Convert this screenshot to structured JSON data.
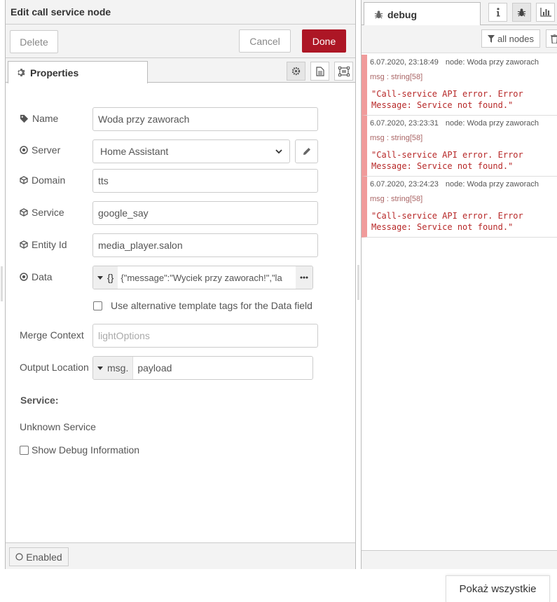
{
  "editor": {
    "title": "Edit call service node",
    "delete_label": "Delete",
    "cancel_label": "Cancel",
    "done_label": "Done",
    "tab_properties": "Properties",
    "form": {
      "name_label": "Name",
      "name_value": "Woda przy zaworach",
      "server_label": "Server",
      "server_value": "Home Assistant",
      "domain_label": "Domain",
      "domain_value": "tts",
      "service_label": "Service",
      "service_value": "google_say",
      "entity_label": "Entity Id",
      "entity_value": "media_player.salon",
      "data_label": "Data",
      "data_type": "{}",
      "data_value": "{\"message\":\"Wyciek przy zaworach!\",\"la",
      "alt_tags_label": "Use alternative template tags for the Data field",
      "merge_label": "Merge Context",
      "merge_placeholder": "lightOptions",
      "output_label": "Output Location",
      "output_type": "msg.",
      "output_value": "payload",
      "service_heading": "Service:",
      "service_text": "Unknown Service",
      "debug_label": "Show Debug Information"
    },
    "enabled_label": "Enabled"
  },
  "sidebar": {
    "tab_debug": "debug",
    "all_nodes_label": "all nodes",
    "messages": [
      {
        "time": "6.07.2020, 23:18:49",
        "node": "node: Woda przy zaworach",
        "type": "msg : string[58]",
        "body": "\"Call-service API error. Error\nMessage: Service not found.\""
      },
      {
        "time": "6.07.2020, 23:23:31",
        "node": "node: Woda przy zaworach",
        "type": "msg : string[58]",
        "body": "\"Call-service API error. Error\nMessage: Service not found.\""
      },
      {
        "time": "6.07.2020, 23:24:23",
        "node": "node: Woda przy zaworach",
        "type": "msg : string[58]",
        "body": "\"Call-service API error. Error\nMessage: Service not found.\""
      }
    ]
  },
  "show_all_label": "Pokaż wszystkie",
  "colors": {
    "done": "#ad1625",
    "debug_error_bar": "#f09b9b",
    "debug_error_text": "#b72828"
  }
}
